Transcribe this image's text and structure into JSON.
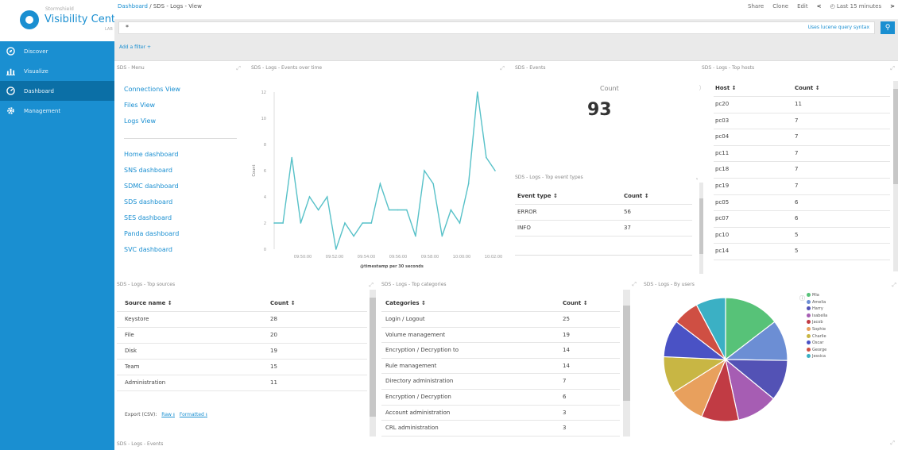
{
  "app": {
    "logo_small": "Stormshield",
    "logo_big": "Visibility Center",
    "logo_lab": "LAB"
  },
  "sidebar": {
    "items": [
      {
        "label": "Discover",
        "icon": "compass-icon"
      },
      {
        "label": "Visualize",
        "icon": "bar-chart-icon"
      },
      {
        "label": "Dashboard",
        "icon": "dashboard-icon"
      },
      {
        "label": "Management",
        "icon": "gear-icon"
      }
    ]
  },
  "breadcrumb": {
    "root": "Dashboard",
    "sep": "/",
    "current": "SDS - Logs - View"
  },
  "toolbar": {
    "share": "Share",
    "clone": "Clone",
    "edit": "Edit",
    "prev": "<",
    "time": "Last 15 minutes",
    "next": ">"
  },
  "search": {
    "value": "*",
    "hint": "Uses lucene query syntax"
  },
  "filter": {
    "add": "Add a filter +"
  },
  "menu": {
    "title": "SDS - Menu",
    "views": [
      "Connections View",
      "Files View",
      "Logs View"
    ],
    "dashboards": [
      "Home dashboard",
      "SNS dashboard",
      "SDMC dashboard",
      "SDS dashboard",
      "SES dashboard",
      "Panda dashboard",
      "SVC dashboard"
    ]
  },
  "events_panel": {
    "title": "SDS - Events",
    "label": "Count",
    "value": "93"
  },
  "top_hosts": {
    "title": "SDS - Logs - Top hosts",
    "columns": [
      "Host ↕",
      "Count ↕"
    ],
    "rows": [
      [
        "pc20",
        "11"
      ],
      [
        "pc03",
        "7"
      ],
      [
        "pc04",
        "7"
      ],
      [
        "pc11",
        "7"
      ],
      [
        "pc18",
        "7"
      ],
      [
        "pc19",
        "7"
      ],
      [
        "pc05",
        "6"
      ],
      [
        "pc07",
        "6"
      ],
      [
        "pc10",
        "5"
      ],
      [
        "pc14",
        "5"
      ]
    ]
  },
  "top_event_types": {
    "title": "SDS - Logs - Top event types",
    "columns": [
      "Event type ↕",
      "Count ↕"
    ],
    "rows": [
      [
        "ERROR",
        "56"
      ],
      [
        "INFO",
        "37"
      ]
    ]
  },
  "top_sources": {
    "title": "SDS - Logs - Top sources",
    "columns": [
      "Source name ↕",
      "Count ↕"
    ],
    "rows": [
      [
        "Keystore",
        "28"
      ],
      [
        "File",
        "20"
      ],
      [
        "Disk",
        "19"
      ],
      [
        "Team",
        "15"
      ],
      [
        "Administration",
        "11"
      ]
    ],
    "export_label": "Export (CSV):",
    "raw": "Raw",
    "formatted": "Formatted"
  },
  "top_categories": {
    "title": "SDS - Logs - Top categories",
    "columns": [
      "Categories ↕",
      "Count ↕"
    ],
    "rows": [
      [
        "Login / Logout",
        "25"
      ],
      [
        "Volume management",
        "19"
      ],
      [
        "Encryption / Decryption to",
        "14"
      ],
      [
        "Rule management",
        "14"
      ],
      [
        "Directory administration",
        "7"
      ],
      [
        "Encryption / Decryption",
        "6"
      ],
      [
        "Account administration",
        "3"
      ],
      [
        "CRL administration",
        "3"
      ]
    ]
  },
  "by_users": {
    "title": "SDS - Logs - By users"
  },
  "bottom": {
    "title": "SDS - Logs - Events"
  },
  "chart_data": [
    {
      "type": "line",
      "title": "SDS - Logs - Events over time",
      "xlabel": "@timestamp per 30 seconds",
      "ylabel": "Count",
      "ylim": [
        0,
        12
      ],
      "yticks": [
        "0",
        "2",
        "4",
        "6",
        "8",
        "10",
        "12"
      ],
      "xticks": [
        "09:50:00",
        "09:52:00",
        "09:54:00",
        "09:56:00",
        "09:58:00",
        "10:00:00",
        "10:02:00"
      ],
      "color": "#57c1c8",
      "series": [
        {
          "values": [
            2,
            2,
            7,
            2,
            4,
            3,
            4,
            0,
            2,
            1,
            2,
            2,
            5,
            3,
            3,
            3,
            1,
            6,
            5,
            1,
            3,
            2,
            5,
            12,
            7,
            6
          ]
        }
      ]
    },
    {
      "type": "pie",
      "title": "SDS - Logs - By users",
      "labels": [
        "Mia",
        "Amelia",
        "Harry",
        "Isabella",
        "Jacob",
        "Sophie",
        "Charlie",
        "Oscar",
        "George",
        "Jessica"
      ],
      "values": [
        15,
        11,
        11,
        11,
        10,
        10,
        10,
        10,
        7,
        8
      ],
      "colors": [
        "#57c278",
        "#6c8ed4",
        "#5352b5",
        "#a65db3",
        "#c13b44",
        "#e8a05d",
        "#c8b644",
        "#4a52c5",
        "#cf4f43",
        "#3bb0c4"
      ]
    }
  ]
}
